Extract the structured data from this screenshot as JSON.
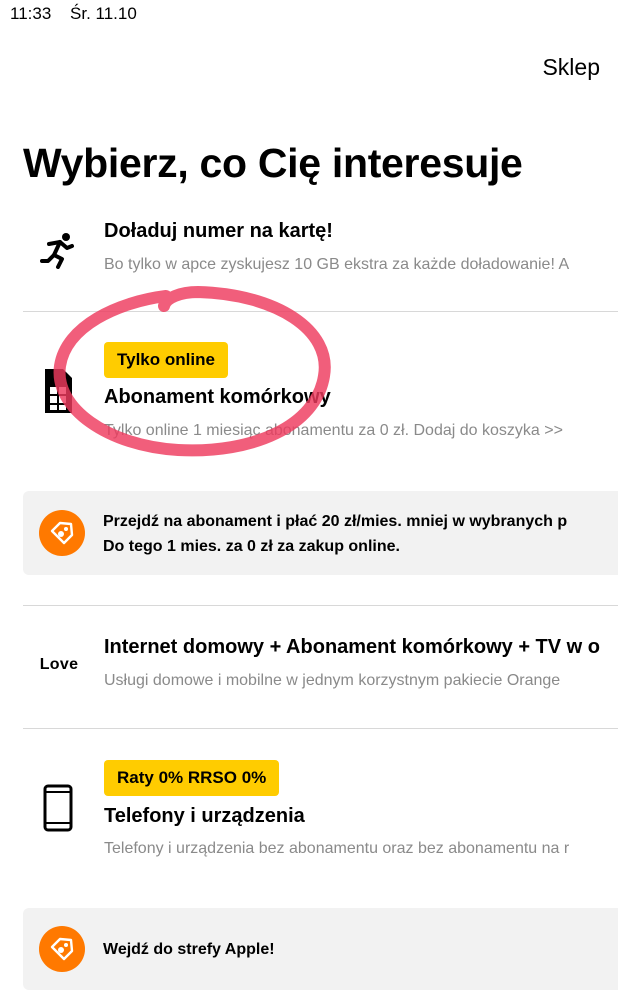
{
  "status": {
    "time": "11:33",
    "date": "Śr. 11.10"
  },
  "header": {
    "shop_label": "Sklep"
  },
  "page": {
    "title": "Wybierz, co Cię interesuje"
  },
  "items": [
    {
      "icon": "running-person-icon",
      "title": "Doładuj numer na kartę!",
      "subtitle": "Bo tylko w apce zyskujesz 10 GB ekstra za każde doładowanie! A"
    },
    {
      "icon": "sim-card-icon",
      "badge": "Tylko online",
      "title": "Abonament komórkowy",
      "subtitle": "Tylko online 1 miesiąc abonamentu za 0 zł. Dodaj do koszyka >>"
    },
    {
      "icon": "love-logo-icon",
      "icon_text": "Love",
      "title": "Internet domowy + Abonament komórkowy + TV w o",
      "subtitle": "Usługi domowe i mobilne w jednym korzystnym pakiecie Orange"
    },
    {
      "icon": "smartphone-icon",
      "badge": "Raty 0% RRSO 0%",
      "title": "Telefony i urządzenia",
      "subtitle": "Telefony i urządzenia bez abonamentu oraz bez abonamentu na r"
    }
  ],
  "promos": [
    {
      "icon": "price-tag-icon",
      "line1": "Przejdź na abonament i płać 20 zł/mies. mniej w wybranych p",
      "line2": "Do tego 1 mies. za 0 zł za zakup online."
    },
    {
      "icon": "price-tag-icon",
      "line1": "Wejdź do strefy Apple!"
    }
  ],
  "colors": {
    "accent_orange": "#ff7900",
    "badge_yellow": "#ffcc00",
    "annotation_red": "#ee3b5e",
    "subtitle_gray": "#8a8a8a",
    "promo_background": "#f2f2f2"
  }
}
